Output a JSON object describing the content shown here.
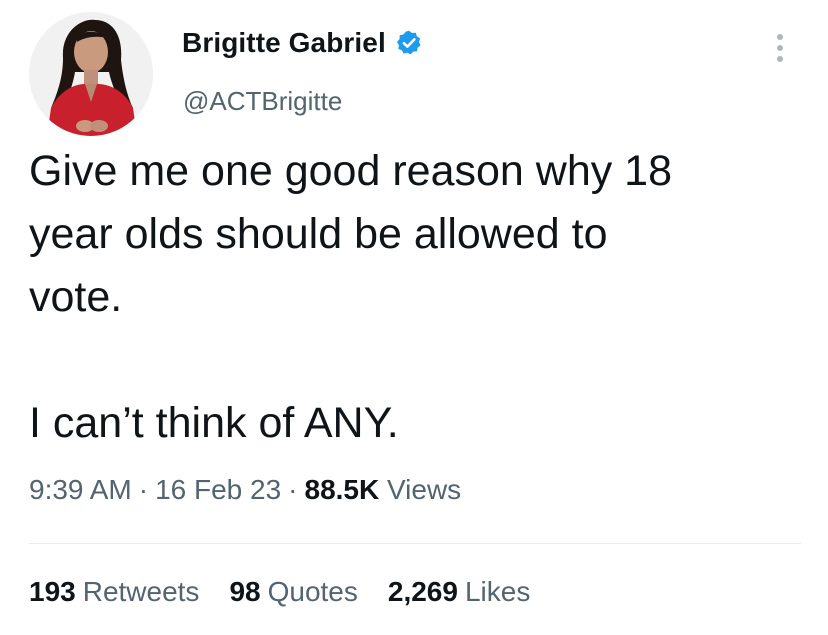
{
  "author": {
    "display_name": "Brigitte Gabriel",
    "handle": "@ACTBrigitte",
    "verified_icon": "verified-badge-icon",
    "verified_color": "#1d9bf0"
  },
  "tweet": {
    "lines": [
      "Give me one good reason why 18",
      "year olds should be allowed to",
      "vote.",
      "I can’t think of ANY."
    ],
    "time": "9:39 AM",
    "date": "16 Feb 23",
    "views_count": "88.5K",
    "views_label": "Views"
  },
  "separator": "·",
  "stats": {
    "retweets": {
      "count": "193",
      "label": "Retweets"
    },
    "quotes": {
      "count": "98",
      "label": "Quotes"
    },
    "likes": {
      "count": "2,269",
      "label": "Likes"
    }
  },
  "colors": {
    "text": "#0f1419",
    "secondary": "#536471",
    "divider": "#e6ecf0"
  }
}
